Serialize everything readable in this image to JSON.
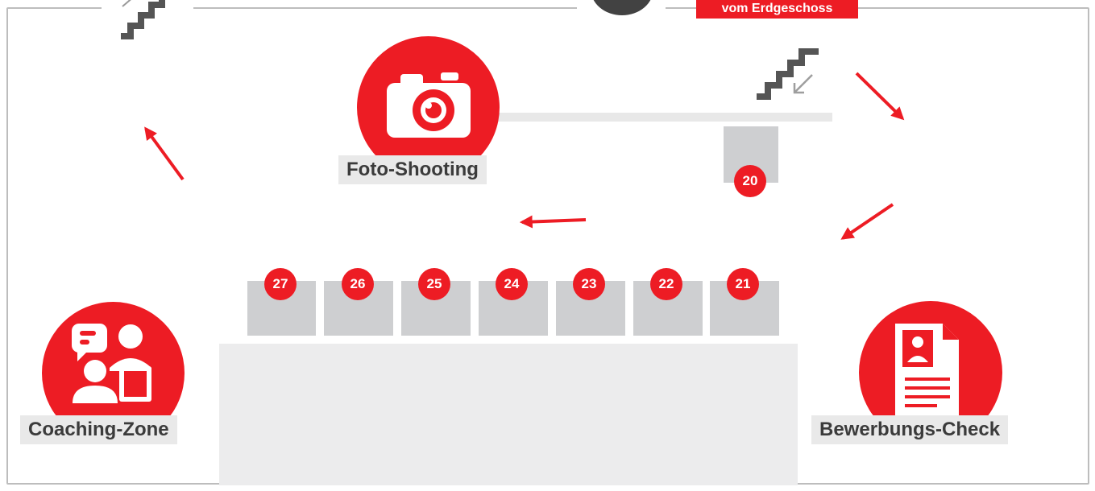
{
  "colors": {
    "accent": "#ed1c24",
    "booth": "#cecfd1",
    "floor": "#ececed",
    "stairs": "#555555",
    "border": "#bdbdbd"
  },
  "top_badge": "vom Erdgeschoss",
  "zones": {
    "foto": {
      "label": "Foto-Shooting",
      "icon": "camera-icon"
    },
    "coaching": {
      "label": "Coaching-Zone",
      "icon": "conversation-icon"
    },
    "bewerbung": {
      "label": "Bewerbungs-Check",
      "icon": "resume-icon"
    }
  },
  "booths": [
    "20",
    "21",
    "22",
    "23",
    "24",
    "25",
    "26",
    "27"
  ],
  "icons": [
    "stairs-up-icon",
    "stairs-down-icon",
    "route-arrow-icon"
  ]
}
